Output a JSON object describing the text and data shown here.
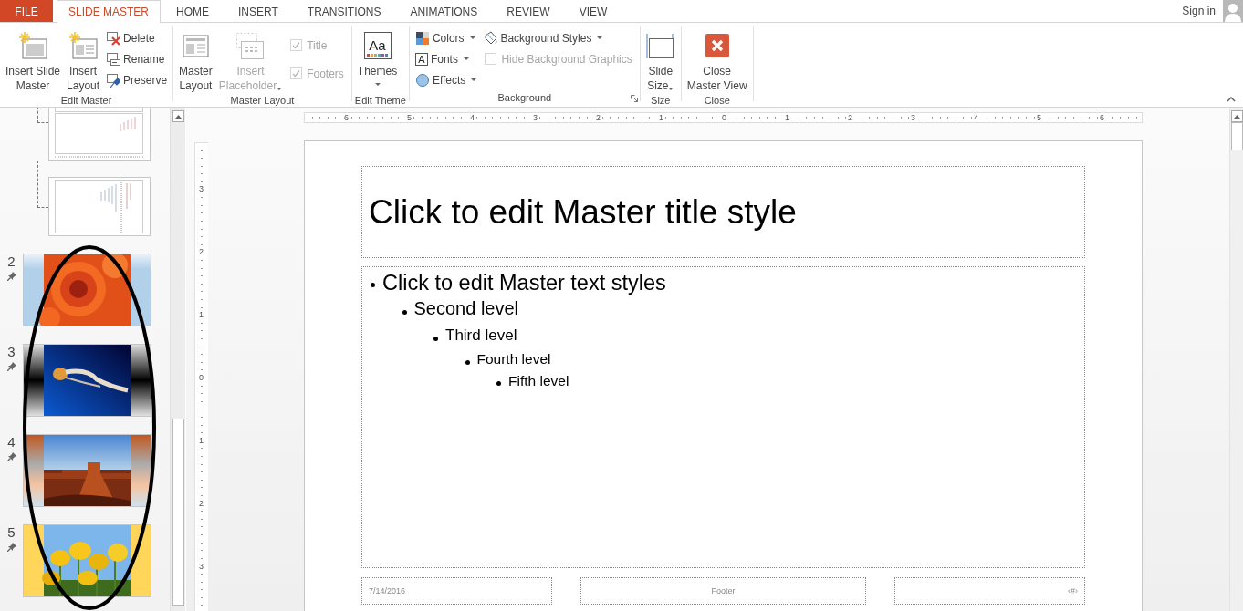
{
  "tabs": [
    {
      "label": "FILE",
      "kind": "file",
      "selected": false
    },
    {
      "label": "SLIDE MASTER",
      "kind": "tab",
      "selected": true
    },
    {
      "label": "HOME",
      "kind": "tab",
      "selected": false
    },
    {
      "label": "INSERT",
      "kind": "tab",
      "selected": false
    },
    {
      "label": "TRANSITIONS",
      "kind": "tab",
      "selected": false
    },
    {
      "label": "ANIMATIONS",
      "kind": "tab",
      "selected": false
    },
    {
      "label": "REVIEW",
      "kind": "tab",
      "selected": false
    },
    {
      "label": "VIEW",
      "kind": "tab",
      "selected": false
    }
  ],
  "account": {
    "label": "Sign in"
  },
  "ribbon": {
    "groups": [
      {
        "label": "Edit Master",
        "launcher": false,
        "columns": [
          [
            {
              "kind": "large",
              "lines": [
                "Insert Slide",
                "Master"
              ],
              "dropdown": false,
              "disabled": false
            }
          ],
          [
            {
              "kind": "large",
              "lines": [
                "Insert",
                "Layout"
              ],
              "dropdown": false,
              "disabled": false
            }
          ],
          [
            {
              "kind": "small",
              "label": "Delete",
              "dropdown": false,
              "disabled": false
            },
            {
              "kind": "small",
              "label": "Rename",
              "dropdown": false,
              "disabled": false
            },
            {
              "kind": "small",
              "label": "Preserve",
              "dropdown": false,
              "disabled": false
            }
          ]
        ]
      },
      {
        "label": "Master Layout",
        "launcher": false,
        "columns": [
          [
            {
              "kind": "large",
              "lines": [
                "Master",
                "Layout"
              ],
              "dropdown": false,
              "disabled": false
            }
          ],
          [
            {
              "kind": "large",
              "lines": [
                "Insert",
                "Placeholder"
              ],
              "dropdown": true,
              "disabled": true
            }
          ],
          [
            {
              "kind": "check",
              "label": "Title",
              "checked": true,
              "disabled": true
            },
            {
              "kind": "check",
              "label": "Footers",
              "checked": true,
              "disabled": true
            }
          ]
        ]
      },
      {
        "label": "Edit Theme",
        "launcher": false,
        "columns": [
          [
            {
              "kind": "large",
              "lines": [
                "Themes"
              ],
              "glyph": "Aa",
              "dropdown": true,
              "disabled": false
            }
          ]
        ]
      },
      {
        "label": "Background",
        "launcher": true,
        "columns": [
          [
            {
              "kind": "small",
              "label": "Colors",
              "dropdown": true,
              "disabled": false
            },
            {
              "kind": "small",
              "label": "Fonts",
              "glyph": "A",
              "dropdown": true,
              "disabled": false
            },
            {
              "kind": "small",
              "label": "Effects",
              "dropdown": true,
              "disabled": false
            }
          ],
          [
            {
              "kind": "small",
              "label": "Background Styles",
              "dropdown": true,
              "disabled": false
            },
            {
              "kind": "check",
              "label": "Hide Background Graphics",
              "checked": false,
              "disabled": true
            }
          ]
        ]
      },
      {
        "label": "Size",
        "launcher": false,
        "columns": [
          [
            {
              "kind": "large",
              "lines": [
                "Slide",
                "Size"
              ],
              "dropdown": true,
              "disabled": false
            }
          ]
        ]
      },
      {
        "label": "Close",
        "launcher": false,
        "columns": [
          [
            {
              "kind": "large",
              "lines": [
                "Close",
                "Master View"
              ],
              "dropdown": false,
              "disabled": false
            }
          ]
        ]
      }
    ]
  },
  "slide_pane": {
    "layouts": [
      {
        "kind": "layout"
      },
      {
        "kind": "layout"
      }
    ],
    "slides": [
      {
        "number": "2",
        "pinned": true,
        "kind": "picture"
      },
      {
        "number": "3",
        "pinned": true,
        "kind": "picture"
      },
      {
        "number": "4",
        "pinned": true,
        "kind": "picture"
      },
      {
        "number": "5",
        "pinned": true,
        "kind": "picture"
      }
    ]
  },
  "rulers": {
    "horizontal": [
      "6",
      "5",
      "4",
      "3",
      "2",
      "1",
      "0",
      "1",
      "2",
      "3",
      "4",
      "5",
      "6"
    ],
    "vertical": [
      "3",
      "2",
      "1",
      "0",
      "1",
      "2",
      "3"
    ]
  },
  "slide": {
    "title": "Click to edit Master title style",
    "body": [
      {
        "text": "Click to edit Master text styles",
        "children": [
          {
            "text": "Second level",
            "children": [
              {
                "text": "Third level",
                "children": [
                  {
                    "text": "Fourth level",
                    "children": [
                      {
                        "text": "Fifth level"
                      }
                    ]
                  }
                ]
              }
            ]
          }
        ]
      }
    ],
    "footer": {
      "date": "7/14/2016",
      "center": "Footer",
      "number": "‹#›"
    }
  }
}
